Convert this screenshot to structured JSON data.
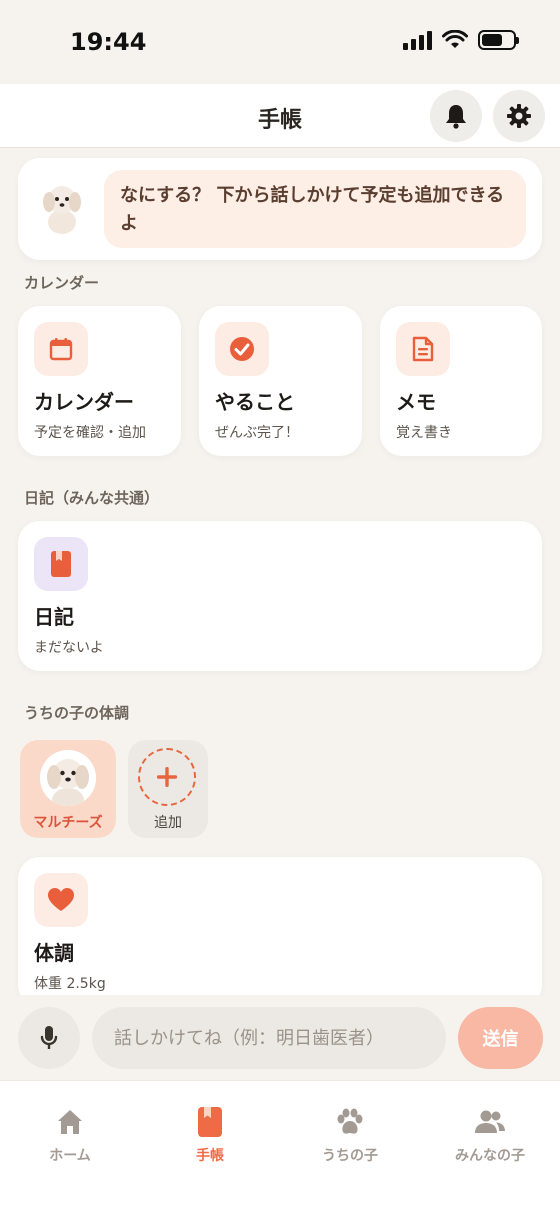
{
  "status": {
    "time": "19:44"
  },
  "header": {
    "title": "手帳"
  },
  "greeting": {
    "message": "なにする？ 下から話しかけて予定も追加できるよ"
  },
  "sections": {
    "calendar": "カレンダー",
    "diary": "日記（みんな共通）",
    "health": "うちの子の体調"
  },
  "tiles": {
    "calendar": {
      "title": "カレンダー",
      "subtitle": "予定を確認・追加",
      "icon": "calendar-icon",
      "color": "#e95f3c"
    },
    "todo": {
      "title": "やること",
      "subtitle": "ぜんぶ完了！",
      "icon": "check-circle-icon",
      "color": "#e95f3c"
    },
    "memo": {
      "title": "メモ",
      "subtitle": "覚え書き",
      "icon": "document-icon",
      "color": "#e95f3c"
    },
    "diary": {
      "title": "日記",
      "subtitle": "まだないよ",
      "icon": "book-icon",
      "color": "#e95f3c"
    },
    "health": {
      "title": "体調",
      "subtitle": "体重 2.5kg",
      "icon": "heart-icon",
      "color": "#e95f3c"
    }
  },
  "pets": {
    "items": [
      {
        "name": "マルチーズ",
        "selected": true
      }
    ],
    "add_label": "追加"
  },
  "composer": {
    "placeholder": "話しかけてね（例：明日歯医者）",
    "send_label": "送信"
  },
  "tabs": [
    {
      "label": "ホーム",
      "icon": "home-icon",
      "active": false
    },
    {
      "label": "手帳",
      "icon": "notebook-icon",
      "active": true
    },
    {
      "label": "うちの子",
      "icon": "paw-icon",
      "active": false
    },
    {
      "label": "みんなの子",
      "icon": "people-icon",
      "active": false
    }
  ],
  "colors": {
    "accent": "#ef6b45",
    "background": "#f6f3ef",
    "bubble": "#fdeee6",
    "send_disabled": "#f9b8a4"
  }
}
